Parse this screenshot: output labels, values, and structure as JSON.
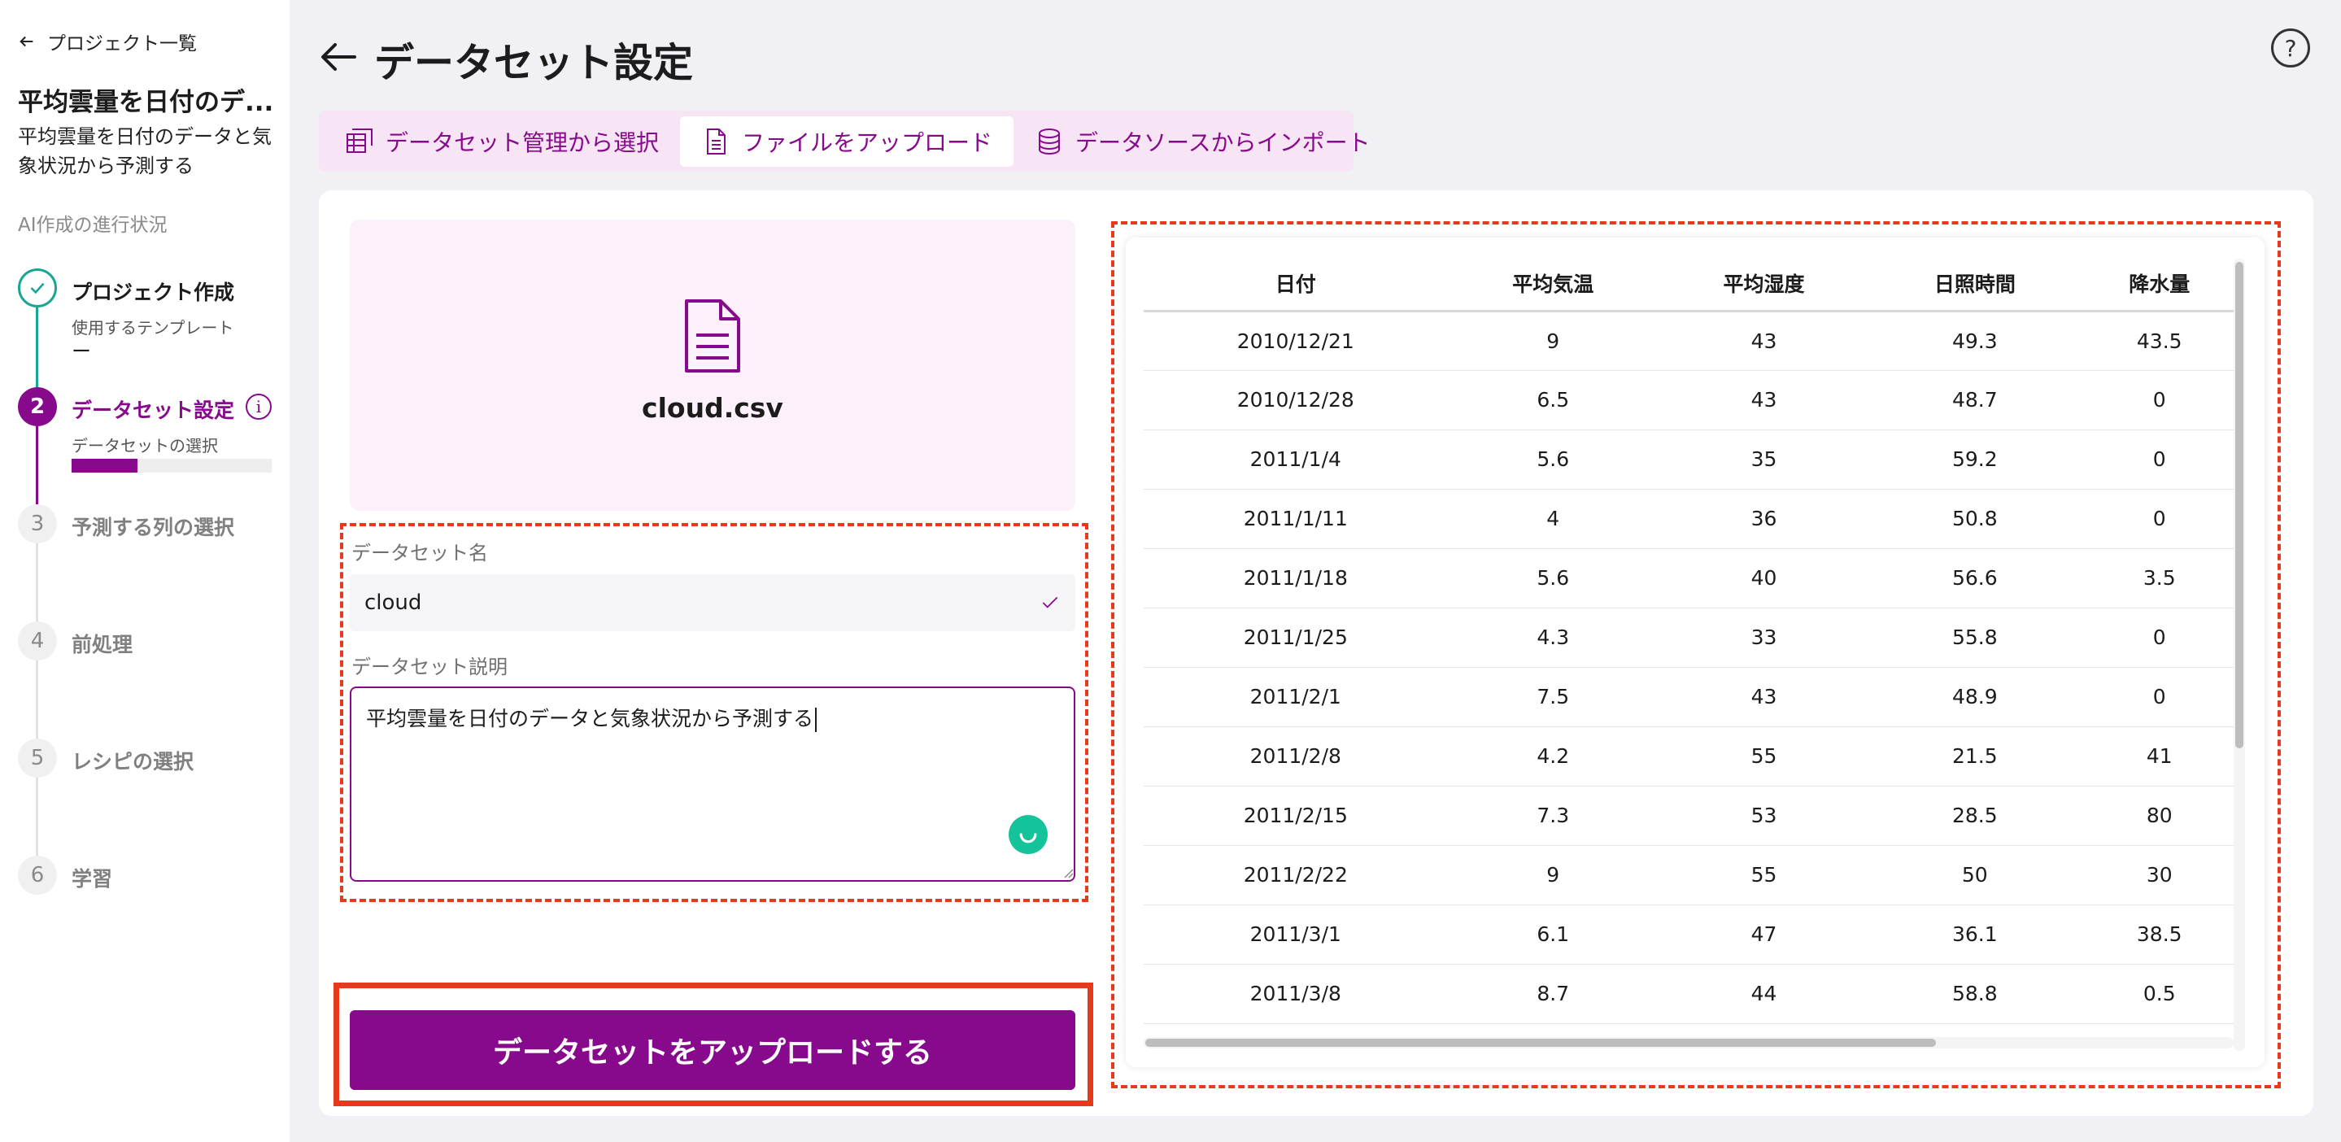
{
  "sidebar": {
    "back_label": "プロジェクト一覧",
    "project_title": "平均雲量を日付のデ...",
    "project_description": "平均雲量を日付のデータと気象状況から予測する",
    "progress_title": "AI作成の進行状況",
    "steps": [
      {
        "number": "✓",
        "label": "プロジェクト作成",
        "sub": "使用するテンプレート",
        "sub2": "ー"
      },
      {
        "number": "2",
        "label": "データセット設定",
        "sub": "データセットの選択",
        "progress": 0.33
      },
      {
        "number": "3",
        "label": "予測する列の選択"
      },
      {
        "number": "4",
        "label": "前処理"
      },
      {
        "number": "5",
        "label": "レシピの選択"
      },
      {
        "number": "6",
        "label": "学習"
      }
    ]
  },
  "header": {
    "title": "データセット設定",
    "help": "?"
  },
  "tabs": [
    {
      "label": "データセット管理から選択",
      "icon": "dataset-manage-icon"
    },
    {
      "label": "ファイルをアップロード",
      "icon": "file-icon"
    },
    {
      "label": "データソースからインポート",
      "icon": "database-icon"
    }
  ],
  "file": {
    "name": "cloud.csv"
  },
  "form": {
    "name_label": "データセット名",
    "name_value": "cloud",
    "desc_label": "データセット説明",
    "desc_value": "平均雲量を日付のデータと気象状況から予測する"
  },
  "upload_button": "データセットをアップロードする",
  "table": {
    "columns": [
      "日付",
      "平均気温",
      "平均湿度",
      "日照時間",
      "降水量"
    ],
    "rows": [
      [
        "2010/12/21",
        "9",
        "43",
        "49.3",
        "43.5"
      ],
      [
        "2010/12/28",
        "6.5",
        "43",
        "48.7",
        "0"
      ],
      [
        "2011/1/4",
        "5.6",
        "35",
        "59.2",
        "0"
      ],
      [
        "2011/1/11",
        "4",
        "36",
        "50.8",
        "0"
      ],
      [
        "2011/1/18",
        "5.6",
        "40",
        "56.6",
        "3.5"
      ],
      [
        "2011/1/25",
        "4.3",
        "33",
        "55.8",
        "0"
      ],
      [
        "2011/2/1",
        "7.5",
        "43",
        "48.9",
        "0"
      ],
      [
        "2011/2/8",
        "4.2",
        "55",
        "21.5",
        "41"
      ],
      [
        "2011/2/15",
        "7.3",
        "53",
        "28.5",
        "80"
      ],
      [
        "2011/2/22",
        "9",
        "55",
        "50",
        "30"
      ],
      [
        "2011/3/1",
        "6.1",
        "47",
        "36.1",
        "38.5"
      ],
      [
        "2011/3/8",
        "8.7",
        "44",
        "58.8",
        "0.5"
      ]
    ]
  },
  "colors": {
    "accent": "#880a8c",
    "done": "#1aa594",
    "highlight": "#e8391f",
    "tab_bar": "#f7e4f5"
  }
}
